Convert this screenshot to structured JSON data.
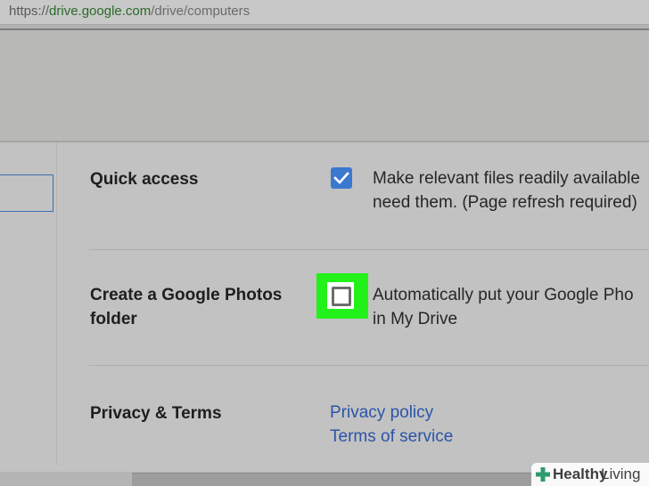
{
  "browser": {
    "url_scheme": "https://",
    "url_host": "drive.google.com",
    "url_path": "/drive/computers"
  },
  "settings": {
    "quick_access": {
      "label": "Quick access",
      "description_line1": "Make relevant files readily available",
      "description_line2": "need them. (Page refresh required)",
      "checked": true
    },
    "google_photos": {
      "label_line1": "Create a Google Photos",
      "label_line2": "folder",
      "description_line1": "Automatically put your Google Pho",
      "description_line2": "in My Drive",
      "checked": false
    },
    "privacy": {
      "label": "Privacy & Terms",
      "privacy_link": "Privacy policy",
      "terms_link": "Terms of service"
    }
  },
  "colors": {
    "accent": "#3b78d0",
    "highlight": "#22f21a",
    "link": "#2a54a8"
  },
  "watermark": {
    "bold": "Healthy",
    "light": "Living"
  }
}
